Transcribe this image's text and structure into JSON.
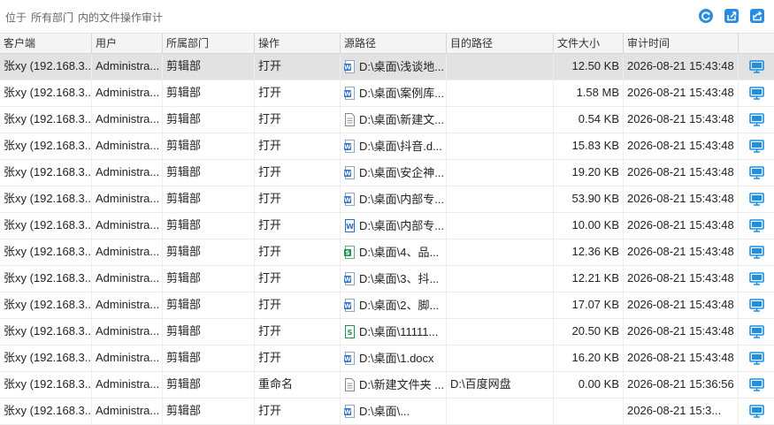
{
  "toolbar": {
    "title_prefix": "位于",
    "scope": "所有部门",
    "title_suffix": "内的文件操作审计",
    "icons": [
      "refresh-icon",
      "export-icon",
      "share-export-icon"
    ],
    "accent_color": "#2a8ce0"
  },
  "table": {
    "columns": [
      "客户端",
      "用户",
      "所属部门",
      "操作",
      "源路径",
      "目的路径",
      "文件大小",
      "审计时间"
    ],
    "rows": [
      {
        "client": "张xy (192.168.3...",
        "user": "Administra...",
        "dept": "剪辑部",
        "op": "打开",
        "icon": "word",
        "src": "D:\\桌面\\浅谈地...",
        "dst": "",
        "size": "12.50 KB",
        "time": "2026-08-21 15:43:48",
        "selected": true
      },
      {
        "client": "张xy (192.168.3...",
        "user": "Administra...",
        "dept": "剪辑部",
        "op": "打开",
        "icon": "word",
        "src": "D:\\桌面\\案例库...",
        "dst": "",
        "size": "1.58 MB",
        "time": "2026-08-21 15:43:48"
      },
      {
        "client": "张xy (192.168.3...",
        "user": "Administra...",
        "dept": "剪辑部",
        "op": "打开",
        "icon": "text",
        "src": "D:\\桌面\\新建文...",
        "dst": "",
        "size": "0.54 KB",
        "time": "2026-08-21 15:43:48"
      },
      {
        "client": "张xy (192.168.3...",
        "user": "Administra...",
        "dept": "剪辑部",
        "op": "打开",
        "icon": "word",
        "src": "D:\\桌面\\抖音.d...",
        "dst": "",
        "size": "15.83 KB",
        "time": "2026-08-21 15:43:48"
      },
      {
        "client": "张xy (192.168.3...",
        "user": "Administra...",
        "dept": "剪辑部",
        "op": "打开",
        "icon": "word",
        "src": "D:\\桌面\\安企神...",
        "dst": "",
        "size": "19.20 KB",
        "time": "2026-08-21 15:43:48"
      },
      {
        "client": "张xy (192.168.3...",
        "user": "Administra...",
        "dept": "剪辑部",
        "op": "打开",
        "icon": "word",
        "src": "D:\\桌面\\内部专...",
        "dst": "",
        "size": "53.90 KB",
        "time": "2026-08-21 15:43:48"
      },
      {
        "client": "张xy (192.168.3...",
        "user": "Administra...",
        "dept": "剪辑部",
        "op": "打开",
        "icon": "word-outline",
        "src": "D:\\桌面\\内部专...",
        "dst": "",
        "size": "10.00 KB",
        "time": "2026-08-21 15:43:48"
      },
      {
        "client": "张xy (192.168.3...",
        "user": "Administra...",
        "dept": "剪辑部",
        "op": "打开",
        "icon": "sheet",
        "src": "D:\\桌面\\4、品...",
        "dst": "",
        "size": "12.36 KB",
        "time": "2026-08-21 15:43:48"
      },
      {
        "client": "张xy (192.168.3...",
        "user": "Administra...",
        "dept": "剪辑部",
        "op": "打开",
        "icon": "word",
        "src": "D:\\桌面\\3、抖...",
        "dst": "",
        "size": "12.21 KB",
        "time": "2026-08-21 15:43:48"
      },
      {
        "client": "张xy (192.168.3...",
        "user": "Administra...",
        "dept": "剪辑部",
        "op": "打开",
        "icon": "word",
        "src": "D:\\桌面\\2、脚...",
        "dst": "",
        "size": "17.07 KB",
        "time": "2026-08-21 15:43:48"
      },
      {
        "client": "张xy (192.168.3...",
        "user": "Administra...",
        "dept": "剪辑部",
        "op": "打开",
        "icon": "sheet-outline",
        "src": "D:\\桌面\\11111...",
        "dst": "",
        "size": "20.50 KB",
        "time": "2026-08-21 15:43:48"
      },
      {
        "client": "张xy (192.168.3...",
        "user": "Administra...",
        "dept": "剪辑部",
        "op": "打开",
        "icon": "word",
        "src": "D:\\桌面\\1.docx",
        "dst": "",
        "size": "16.20 KB",
        "time": "2026-08-21 15:43:48"
      },
      {
        "client": "张xy (192.168.3...",
        "user": "Administra...",
        "dept": "剪辑部",
        "op": "重命名",
        "icon": "text",
        "src": "D:\\新建文件夹 ...",
        "dst": "D:\\百度网盘",
        "size": "0.00 KB",
        "time": "2026-08-21 15:36:56"
      },
      {
        "client": "张xy (192.168.3...",
        "user": "Administra...",
        "dept": "剪辑部",
        "op": "打开",
        "icon": "word",
        "src": "D:\\桌面\\...",
        "dst": "",
        "size": "",
        "time": "2026-08-21 15:3..."
      }
    ]
  }
}
